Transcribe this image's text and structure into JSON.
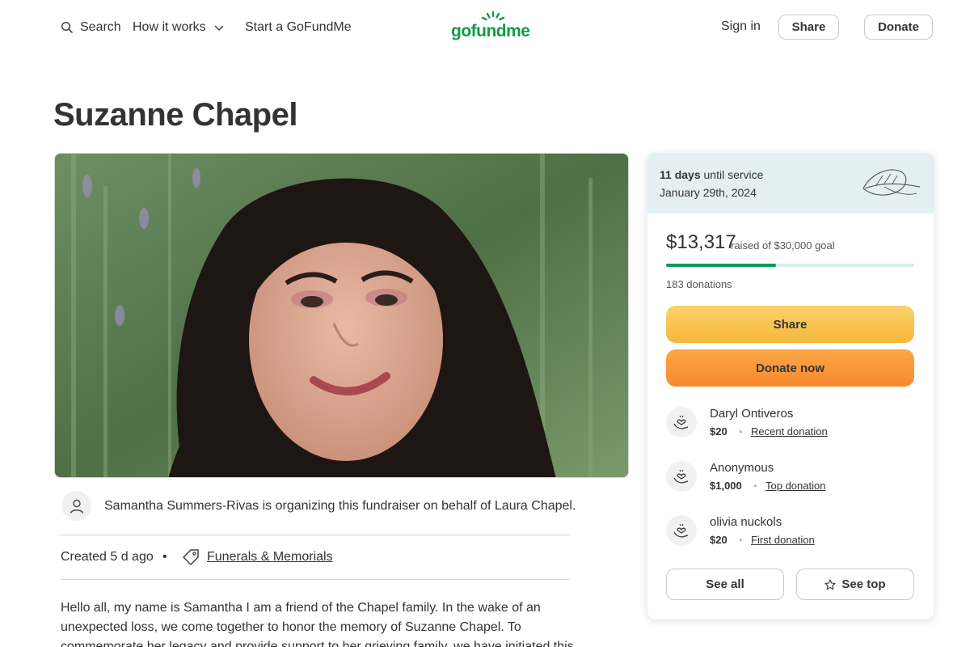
{
  "header": {
    "search_label": "Search",
    "how_label": "How it works",
    "start_label": "Start a GoFundMe",
    "logo_text": "gofundme",
    "signin_label": "Sign in",
    "share_label": "Share",
    "donate_label": "Donate"
  },
  "campaign": {
    "title": "Suzanne Chapel",
    "organizer_text": "Samantha Summers-Rivas is organizing this fundraiser on behalf of Laura Chapel.",
    "created": "Created 5 d ago",
    "separator": "•",
    "category": "Funerals & Memorials",
    "story": "Hello all, my name is Samantha I am a friend of the Chapel family. In the wake of an unexpected loss, we come together to honor the memory of Suzanne Chapel. To commemorate her legacy and provide support to her grieving family, we have initiated this"
  },
  "sidebar": {
    "service_days": "11 days",
    "service_suffix": "until service",
    "service_date": "January 29th, 2024",
    "raised": "$13,317",
    "goal_text": "raised of $30,000 goal",
    "progress_fraction": 0.444,
    "donations_count": "183 donations",
    "share_button": "Share",
    "donate_button": "Donate now",
    "donors": [
      {
        "name": "Daryl Ontiveros",
        "amount": "$20",
        "type": "Recent donation"
      },
      {
        "name": "Anonymous",
        "amount": "$1,000",
        "type": "Top donation"
      },
      {
        "name": "olivia nuckols",
        "amount": "$20",
        "type": "First donation"
      }
    ],
    "see_all": "See all",
    "see_top": "See top"
  },
  "colors": {
    "brand_green": "#0f9a47",
    "progress_green": "#0a9a5c",
    "share_yellow": "#f6b73c",
    "donate_orange": "#f7882f",
    "service_bg": "#e4eff4"
  },
  "icons": [
    "search-icon",
    "chevron-down-icon",
    "user-icon",
    "tag-icon",
    "leaf-icon",
    "donation-hands-icon",
    "star-icon"
  ]
}
